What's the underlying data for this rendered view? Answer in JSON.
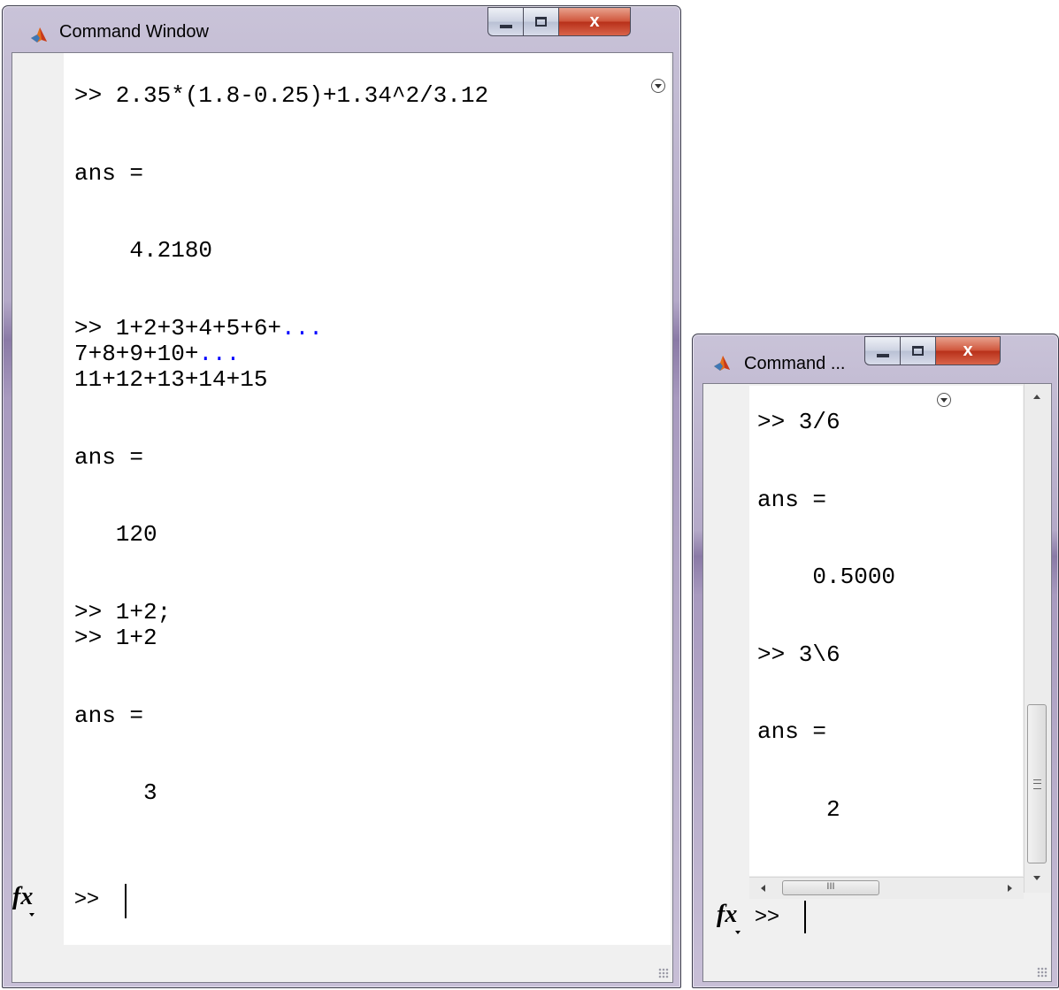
{
  "colors": {
    "continuation": "#0000ff",
    "text": "#000000",
    "close_button": "#c8452c",
    "frame": "#b4a9c8"
  },
  "left_window": {
    "title": "Command Window",
    "icon": "matlab-logo-icon",
    "lines": [
      {
        "text": ">> 2.35*(1.8-0.25)+1.34^2/3.12",
        "cont": ""
      },
      {
        "text": "",
        "cont": ""
      },
      {
        "text": "",
        "cont": ""
      },
      {
        "text": "ans =",
        "cont": ""
      },
      {
        "text": "",
        "cont": ""
      },
      {
        "text": "",
        "cont": ""
      },
      {
        "text": "    4.2180",
        "cont": ""
      },
      {
        "text": "",
        "cont": ""
      },
      {
        "text": "",
        "cont": ""
      },
      {
        "text": ">> 1+2+3+4+5+6+",
        "cont": "..."
      },
      {
        "text": "7+8+9+10+",
        "cont": "..."
      },
      {
        "text": "11+12+13+14+15",
        "cont": ""
      },
      {
        "text": "",
        "cont": ""
      },
      {
        "text": "",
        "cont": ""
      },
      {
        "text": "ans =",
        "cont": ""
      },
      {
        "text": "",
        "cont": ""
      },
      {
        "text": "",
        "cont": ""
      },
      {
        "text": "   120",
        "cont": ""
      },
      {
        "text": "",
        "cont": ""
      },
      {
        "text": "",
        "cont": ""
      },
      {
        "text": ">> 1+2;",
        "cont": ""
      },
      {
        "text": ">> 1+2",
        "cont": ""
      },
      {
        "text": "",
        "cont": ""
      },
      {
        "text": "",
        "cont": ""
      },
      {
        "text": "ans =",
        "cont": ""
      },
      {
        "text": "",
        "cont": ""
      },
      {
        "text": "",
        "cont": ""
      },
      {
        "text": "     3",
        "cont": ""
      }
    ],
    "fx_label": "fx",
    "prompt": ">>"
  },
  "right_window": {
    "title": "Command ...",
    "icon": "matlab-logo-icon",
    "lines": [
      {
        "text": ">> 3/6",
        "cont": ""
      },
      {
        "text": "",
        "cont": ""
      },
      {
        "text": "",
        "cont": ""
      },
      {
        "text": "ans =",
        "cont": ""
      },
      {
        "text": "",
        "cont": ""
      },
      {
        "text": "",
        "cont": ""
      },
      {
        "text": "    0.5000",
        "cont": ""
      },
      {
        "text": "",
        "cont": ""
      },
      {
        "text": "",
        "cont": ""
      },
      {
        "text": ">> 3\\6",
        "cont": ""
      },
      {
        "text": "",
        "cont": ""
      },
      {
        "text": "",
        "cont": ""
      },
      {
        "text": "ans =",
        "cont": ""
      },
      {
        "text": "",
        "cont": ""
      },
      {
        "text": "",
        "cont": ""
      },
      {
        "text": "     2",
        "cont": ""
      }
    ],
    "fx_label": "fx",
    "prompt": ">>",
    "hscroll_thumb": "III"
  }
}
